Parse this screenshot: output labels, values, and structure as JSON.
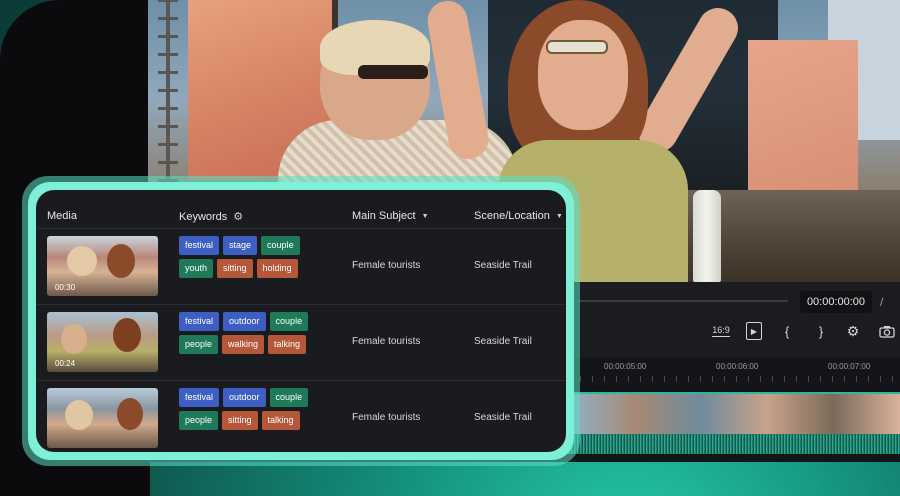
{
  "colors": {
    "accent": "#5fe3c6",
    "tag_blue": "#3d5fc4",
    "tag_green": "#1f7a5a",
    "tag_orange": "#b5583a",
    "panel_bg": "#1a1b1f"
  },
  "player": {
    "timecode": "00:00:00:00",
    "timecode_separator": "/",
    "controls": [
      {
        "name": "aspect-ratio-icon",
        "label": "16:9"
      },
      {
        "name": "play-icon",
        "glyph": "▶"
      },
      {
        "name": "mark-in-icon",
        "glyph": "{"
      },
      {
        "name": "mark-out-icon",
        "glyph": "}"
      },
      {
        "name": "settings-icon",
        "glyph": "⚙"
      },
      {
        "name": "snapshot-icon",
        "glyph": "📷"
      }
    ]
  },
  "timeline": {
    "ruler_labels": [
      "00:00:05:00",
      "00:00:06:00",
      "00:00:07:00"
    ]
  },
  "media_panel": {
    "columns": {
      "media": "Media",
      "keywords": "Keywords",
      "main_subject": "Main Subject",
      "scene_location": "Scene/Location"
    },
    "rows": [
      {
        "duration": "00:30",
        "tags": [
          {
            "text": "festival",
            "color": "blue"
          },
          {
            "text": "stage",
            "color": "blue"
          },
          {
            "text": "couple",
            "color": "green"
          },
          {
            "text": "youth",
            "color": "green"
          },
          {
            "text": "sitting",
            "color": "orange"
          },
          {
            "text": "holding",
            "color": "orange"
          }
        ],
        "main_subject": "Female tourists",
        "scene": "Seaside Trail"
      },
      {
        "duration": "00:24",
        "tags": [
          {
            "text": "festival",
            "color": "blue"
          },
          {
            "text": "outdoor",
            "color": "blue"
          },
          {
            "text": "couple",
            "color": "green"
          },
          {
            "text": "people",
            "color": "green"
          },
          {
            "text": "walking",
            "color": "orange"
          },
          {
            "text": "talking",
            "color": "orange"
          }
        ],
        "main_subject": "Female tourists",
        "scene": "Seaside Trail"
      },
      {
        "duration": "",
        "tags": [
          {
            "text": "festival",
            "color": "blue"
          },
          {
            "text": "outdoor",
            "color": "blue"
          },
          {
            "text": "couple",
            "color": "green"
          },
          {
            "text": "people",
            "color": "green"
          },
          {
            "text": "sitting",
            "color": "orange"
          },
          {
            "text": "talking",
            "color": "orange"
          }
        ],
        "main_subject": "Female tourists",
        "scene": "Seaside Trail"
      }
    ]
  }
}
